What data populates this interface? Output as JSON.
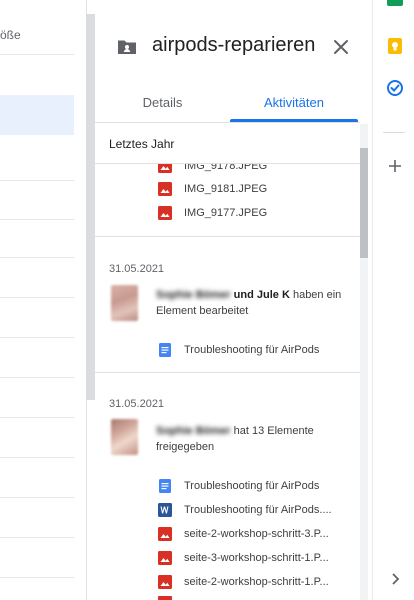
{
  "file_list": {
    "column_header": "öße"
  },
  "panel": {
    "title": "airpods-reparieren",
    "tabs": [
      "Details",
      "Aktivitäten"
    ],
    "section_label": "Letztes Jahr",
    "top_files": [
      "IMG_9178.JPEG",
      "IMG_9181.JPEG",
      "IMG_9177.JPEG"
    ],
    "activity1": {
      "date": "31.05.2021",
      "actor_first": "Sophie Bömer",
      "connector": "und",
      "actor_second": "Jule K",
      "action": "haben ein Element bearbeitet",
      "files": [
        "Troubleshooting für AirPods"
      ]
    },
    "activity2": {
      "date": "31.05.2021",
      "actor": "Sophie Bömer",
      "action": "hat 13 Elemente freigegeben",
      "files": [
        "Troubleshooting für AirPods",
        "Troubleshooting für AirPods....",
        "seite-2-workshop-schritt-3.P...",
        "seite-3-workshop-schritt-1.P...",
        "seite-2-workshop-schritt-1.P..."
      ]
    }
  },
  "icons": {
    "folder": "shared-folder-icon",
    "close": "close-icon",
    "image": "image-file-icon",
    "docs": "google-docs-icon",
    "word": "word-doc-icon"
  },
  "colors": {
    "accent": "#1a73e8",
    "image_red": "#d93025",
    "docs_blue": "#4285f4",
    "word_blue": "#2b579a",
    "keep_yellow": "#fbbc04",
    "sheets_green": "#0f9d58"
  }
}
